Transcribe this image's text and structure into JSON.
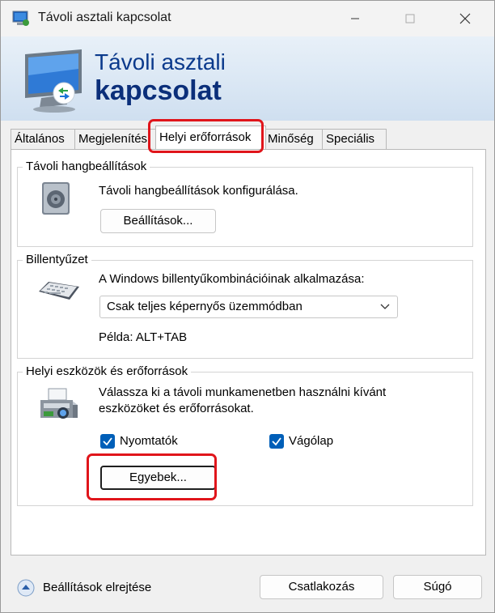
{
  "window": {
    "title": "Távoli asztali kapcsolat"
  },
  "banner": {
    "line1": "Távoli asztali",
    "line2": "kapcsolat"
  },
  "tabs": [
    {
      "label": "Általános"
    },
    {
      "label": "Megjelenítés"
    },
    {
      "label": "Helyi erőforrások",
      "active": true
    },
    {
      "label": "Minőség"
    },
    {
      "label": "Speciális"
    }
  ],
  "sound": {
    "title": "Távoli hangbeállítások",
    "description": "Távoli hangbeállítások konfigurálása.",
    "button": "Beállítások..."
  },
  "keyboard": {
    "title": "Billentyűzet",
    "description": "A Windows billentyűkombinációinak alkalmazása:",
    "selected": "Csak teljes képernyős üzemmódban",
    "example": "Példa: ALT+TAB"
  },
  "devices": {
    "title": "Helyi eszközök és erőforrások",
    "description_line1": "Válassza ki a távoli munkamenetben használni kívánt",
    "description_line2": "eszközöket és erőforrásokat.",
    "printers": {
      "label": "Nyomtatók",
      "checked": true
    },
    "clipboard": {
      "label": "Vágólap",
      "checked": true
    },
    "more_button": "Egyebek..."
  },
  "footer": {
    "hide_options": "Beállítások elrejtése",
    "connect": "Csatlakozás",
    "help": "Súgó"
  },
  "colors": {
    "highlight": "#e0151b",
    "accent": "#005fb8",
    "banner_text": "#0b2f7a"
  }
}
